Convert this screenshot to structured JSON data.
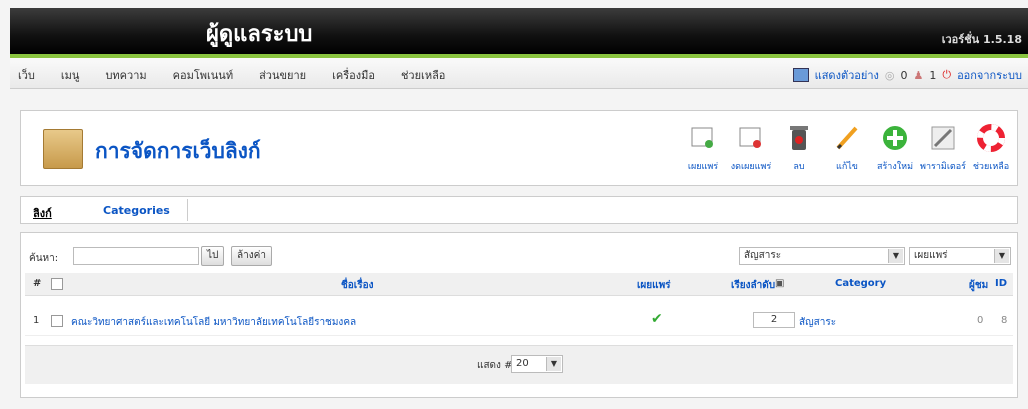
{
  "app": {
    "title": "ผู้ดูแลระบบ",
    "version": "เวอร์ชั่น 1.5.18"
  },
  "menu": [
    "เว็บ",
    "เมนู",
    "บทความ",
    "คอมโพเนนท์",
    "ส่วนขยาย",
    "เครื่องมือ",
    "ช่วยเหลือ"
  ],
  "status": {
    "preview": "แสดงตัวอย่าง",
    "messages": "0",
    "users": "1",
    "logout": "ออกจากระบบ"
  },
  "page": {
    "title": "การจัดการเว็บลิงก์"
  },
  "toolbar": {
    "publish": "เผยแพร่",
    "unpublish": "งดเผยแพร่",
    "delete": "ลบ",
    "edit": "แก้ไข",
    "new": "สร้างใหม่",
    "params": "พารามิเตอร์",
    "help": "ช่วยเหลือ"
  },
  "subnav": {
    "links": "ลิงก์",
    "categories": "Categories"
  },
  "filter": {
    "label": "ค้นหา:",
    "value": "",
    "go": "ไป",
    "reset": "ล้างค่า",
    "category": "สัญสาระ",
    "state": "เผยแพร่"
  },
  "table": {
    "headers": {
      "num": "#",
      "title": "ชื่อเรื่อง",
      "published": "เผยแพร่",
      "order": "เรียงลำดับ",
      "category": "Category",
      "hits": "ผู้ชม",
      "id": "ID"
    },
    "rows": [
      {
        "num": "1",
        "title": "คณะวิทยาศาสตร์และเทคโนโลยี มหาวิทยาลัยเทคโนโลยีราชมงคล",
        "published": "✔",
        "order": "2",
        "category": "สัญสาระ",
        "hits": "0",
        "id": "8"
      }
    ]
  },
  "footer": {
    "display_label": "แสดง #",
    "limit": "20"
  },
  "colors": {
    "accent": "#8ac43f",
    "link": "#0b55c4"
  }
}
